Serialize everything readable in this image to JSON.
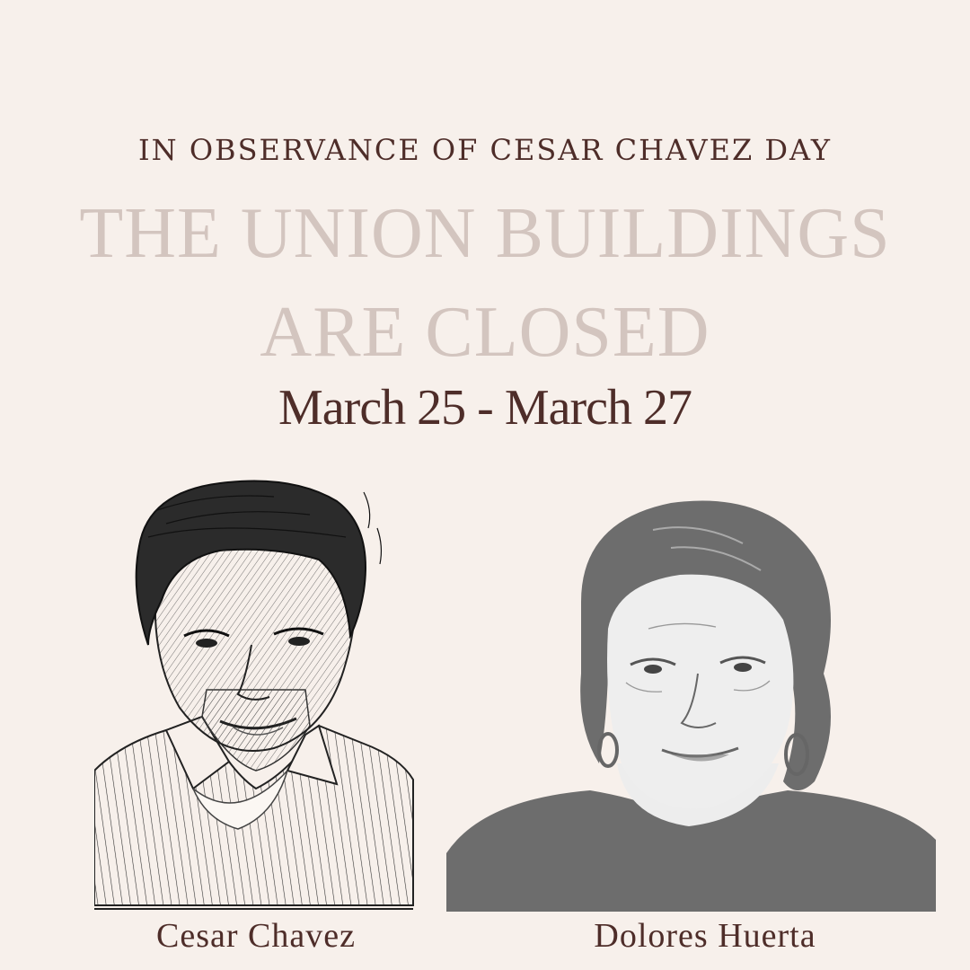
{
  "eyebrow": "IN OBSERVANCE OF CESAR CHAVEZ DAY",
  "headline": {
    "line1": "THE UNION BUILDINGS",
    "line2": "ARE CLOSED"
  },
  "dates": "March 25 - March 27",
  "portraits": [
    {
      "caption": "Cesar Chavez",
      "style": "pen-sketch"
    },
    {
      "caption": "Dolores Huerta",
      "style": "gray-illustration"
    }
  ],
  "colors": {
    "background": "#f7f0eb",
    "text_dark": "#4e2d29",
    "headline_light": "#d3c5bf",
    "illustration_gray": "#6d6d6d"
  }
}
